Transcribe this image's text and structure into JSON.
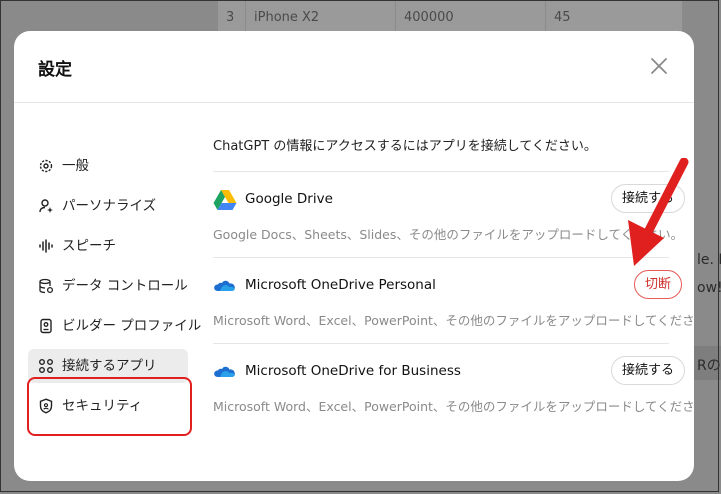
{
  "background": {
    "table_row": [
      "3",
      "iPhone X2",
      "400000",
      "45"
    ],
    "snippets": {
      "right1": "le. I",
      "right2": "ow!",
      "right3": "Rの"
    }
  },
  "modal": {
    "title": "設定",
    "close_icon": "close-icon"
  },
  "sidebar": {
    "items": [
      {
        "label": "一般",
        "icon": "gear-icon"
      },
      {
        "label": "パーソナライズ",
        "icon": "person-sparkle-icon"
      },
      {
        "label": "スピーチ",
        "icon": "waveform-icon"
      },
      {
        "label": "データ コントロール",
        "icon": "database-icon"
      },
      {
        "label": "ビルダー プロファイル",
        "icon": "id-card-icon"
      },
      {
        "label": "接続するアプリ",
        "icon": "apps-grid-icon",
        "active": true
      },
      {
        "label": "セキュリティ",
        "icon": "shield-lock-icon"
      }
    ]
  },
  "content": {
    "intro": "ChatGPT の情報にアクセスするにはアプリを接続してください。",
    "apps": [
      {
        "name": "Google Drive",
        "icon": "google-drive-icon",
        "desc": "Google Docs、Sheets、Slides、その他のファイルをアップロードしてください。",
        "button": "接続する"
      },
      {
        "name": "Microsoft OneDrive Personal",
        "icon": "onedrive-icon",
        "desc": "Microsoft Word、Excel、PowerPoint、その他のファイルをアップロードしてください。",
        "button": "切断"
      },
      {
        "name": "Microsoft OneDrive for Business",
        "icon": "onedrive-icon",
        "desc": "Microsoft Word、Excel、PowerPoint、その他のファイルをアップロードしてください。",
        "button": "接続する"
      }
    ]
  },
  "colors": {
    "accent_red": "#e0201f",
    "danger_text": "#d0312d",
    "onedrive_blue": "#1c6fd1"
  }
}
